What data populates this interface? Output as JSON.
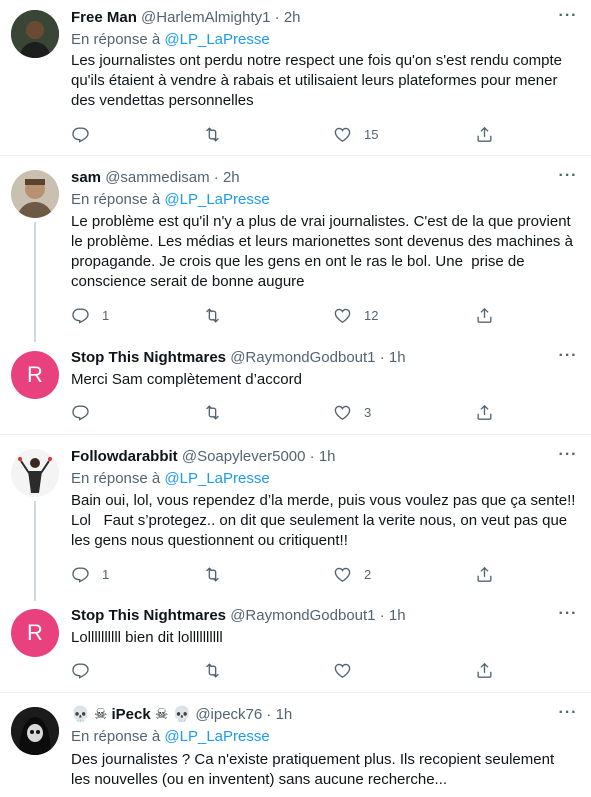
{
  "colors": {
    "accent": "#1d9bf0",
    "secondary_text": "#536471",
    "r_avatar": "#e8417e"
  },
  "more_label": "···",
  "reply_prefix": "En réponse à",
  "tweets": [
    {
      "name": "Free Man",
      "handle": "@HarlemAlmighty1",
      "time": "2h",
      "reply_to": "@LP_LaPresse",
      "text": "Les journalistes ont perdu notre respect une fois qu'on s'est rendu compte qu'ils étaient à vendre à rabais et utilisaient leurs plateformes pour mener des vendettas personnelles",
      "replies": "",
      "retweets": "",
      "likes": "15"
    },
    {
      "name": "sam",
      "handle": "@sammedisam",
      "time": "2h",
      "reply_to": "@LP_LaPresse",
      "text": "Le problème est qu'il n'y a plus de vrai journalistes. C'est de la que provient le problème. Les médias et leurs marionettes sont devenus des machines à propagande. Je crois que les gens en ont le ras le bol. Une  prise de conscience serait de bonne augure",
      "replies": "1",
      "retweets": "",
      "likes": "12"
    },
    {
      "name": "Stop This Nightmares",
      "handle": "@RaymondGodbout1",
      "time": "1h",
      "avatar_letter": "R",
      "text": "Merci Sam complètement d’accord",
      "replies": "",
      "retweets": "",
      "likes": "3"
    },
    {
      "name": "Followdarabbit",
      "handle": "@Soapylever5000",
      "time": "1h",
      "reply_to": "@LP_LaPresse",
      "text": "Bain oui, lol, vous rependez d’la merde, puis vous voulez pas que ça sente!! Lol   Faut s’protegez.. on dit que seulement la verite nous, on veut pas que les gens nous questionnent ou critiquent!!",
      "replies": "1",
      "retweets": "",
      "likes": "2"
    },
    {
      "name": "Stop This Nightmares",
      "handle": "@RaymondGodbout1",
      "time": "1h",
      "avatar_letter": "R",
      "text": "Lollllllllll bien dit lollllllllll",
      "replies": "",
      "retweets": "",
      "likes": ""
    },
    {
      "name": "iPeck",
      "handle": "@ipeck76",
      "time": "1h",
      "name_prefix": "💀 ☠ ",
      "name_suffix": " ☠ 💀",
      "reply_to": "@LP_LaPresse",
      "text": "Des journalistes ? Ca n'existe pratiquement plus. Ils recopient seulement les nouvelles (ou en inventent) sans aucune recherche...",
      "replies": "",
      "retweets": "",
      "likes": ""
    }
  ]
}
